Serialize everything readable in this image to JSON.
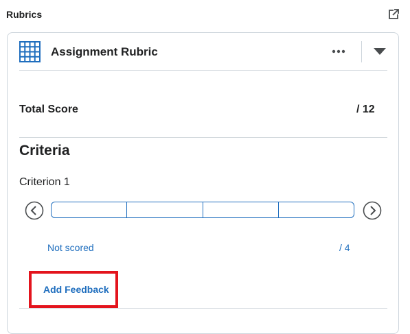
{
  "panel": {
    "title": "Rubrics",
    "popout_icon": "popout-icon"
  },
  "rubric": {
    "title": "Assignment Rubric",
    "icon": "grid-icon",
    "more_icon": "more-horizontal-icon",
    "collapse_icon": "caret-down-icon"
  },
  "total": {
    "label": "Total Score",
    "value": "/ 12"
  },
  "criteria": {
    "heading": "Criteria",
    "items": [
      {
        "name": "Criterion 1",
        "levels_count": 4,
        "status": "Not scored",
        "out_of": "/ 4"
      }
    ]
  },
  "feedback": {
    "label": "Add Feedback"
  },
  "colors": {
    "accent": "#1f6ebe",
    "highlight": "#e3141d",
    "border": "#cdd5dc"
  }
}
